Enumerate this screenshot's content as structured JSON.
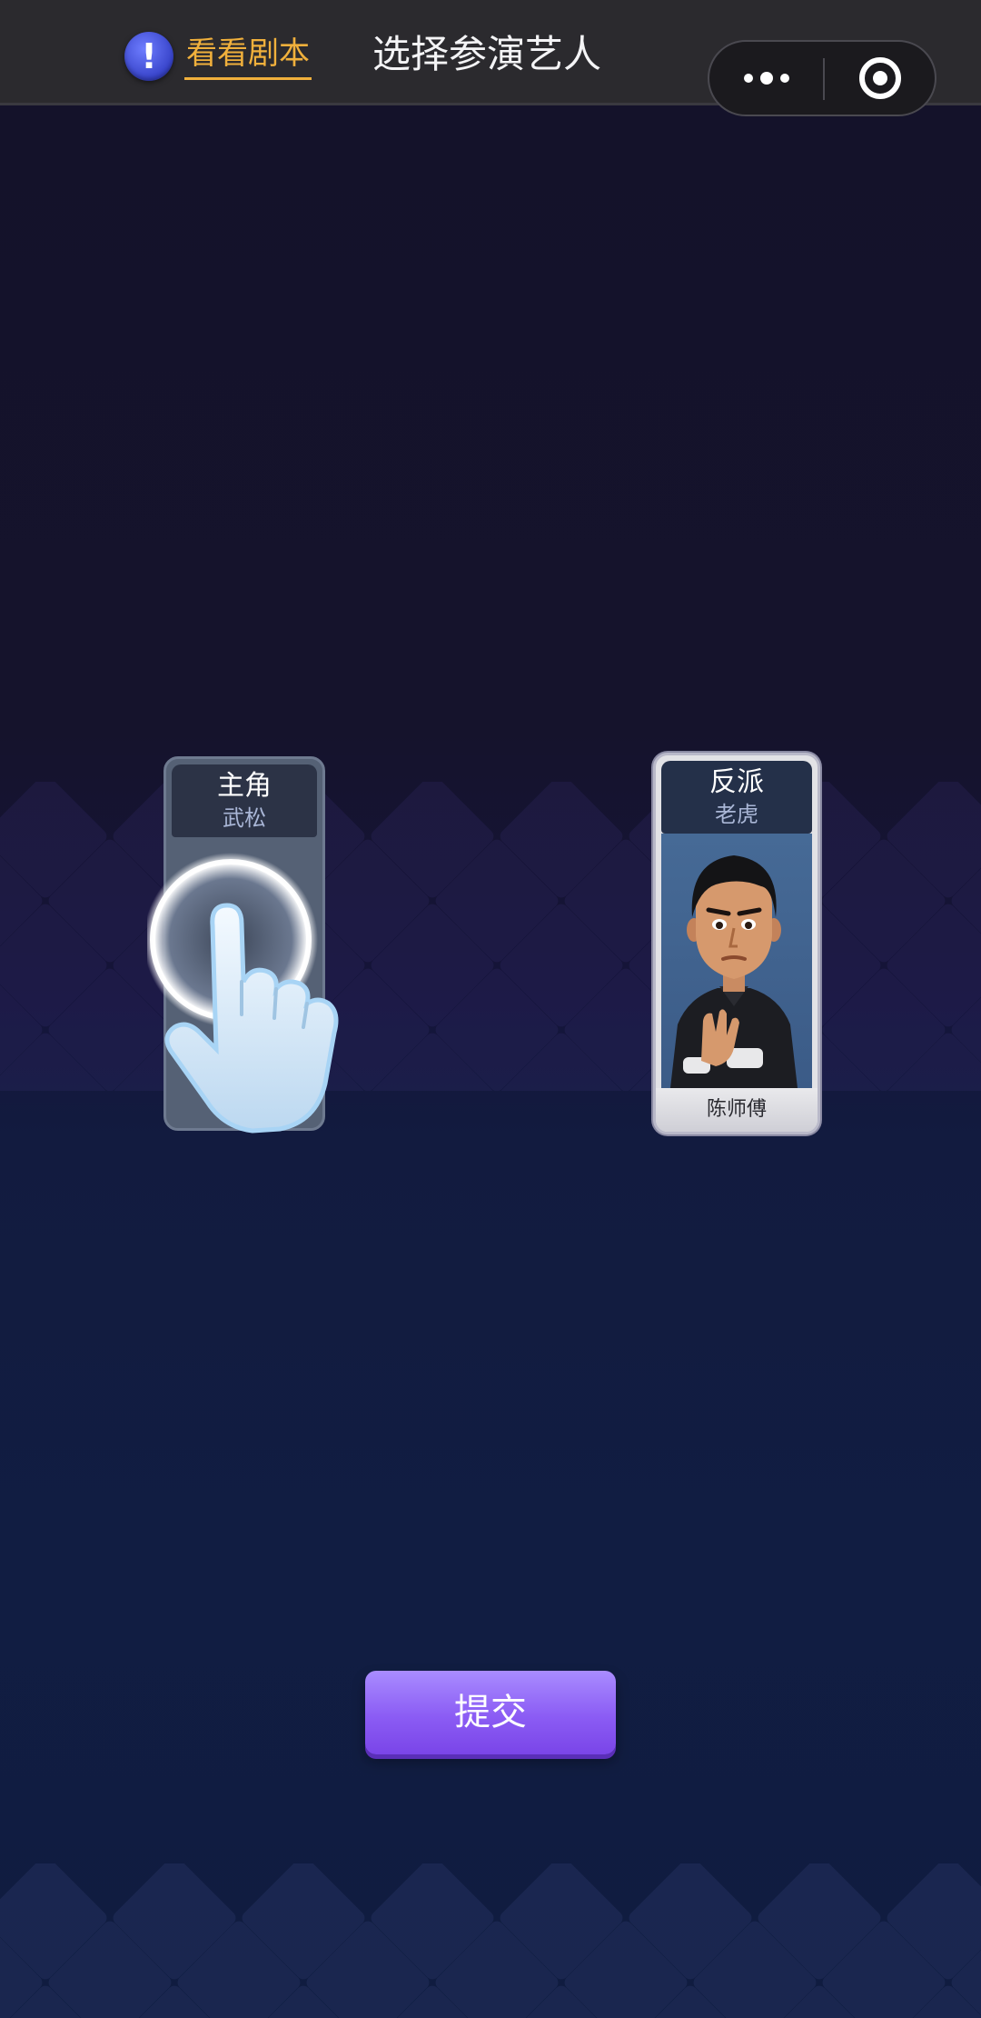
{
  "header": {
    "script_link_label": "看看剧本",
    "title": "选择参演艺人",
    "info_icon": "exclamation-icon",
    "more_icon": "more-dots-icon",
    "close_icon": "target-circle-icon"
  },
  "cards": [
    {
      "role": "主角",
      "character": "武松",
      "actor": "",
      "selected": false
    },
    {
      "role": "反派",
      "character": "老虎",
      "actor": "陈师傅",
      "selected": true
    }
  ],
  "submit_label": "提交",
  "colors": {
    "accent": "#f0b03c",
    "submit": "#8b5cf4",
    "background": "#121b3f"
  }
}
